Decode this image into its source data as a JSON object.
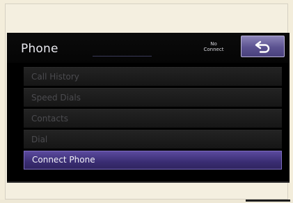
{
  "header": {
    "title": "Phone",
    "status_line1": "No",
    "status_line2": "Connect",
    "back_icon": "return-arrow-icon"
  },
  "menu": {
    "items": [
      {
        "label": "Call History",
        "enabled": false
      },
      {
        "label": "Speed Dials",
        "enabled": false
      },
      {
        "label": "Contacts",
        "enabled": false
      },
      {
        "label": "Dial",
        "enabled": false
      },
      {
        "label": "Connect Phone",
        "enabled": true,
        "selected": true
      }
    ]
  },
  "colors": {
    "accent": "#5b4a9e",
    "screen_bg": "#000000",
    "frame_bg": "#f4efe0"
  }
}
